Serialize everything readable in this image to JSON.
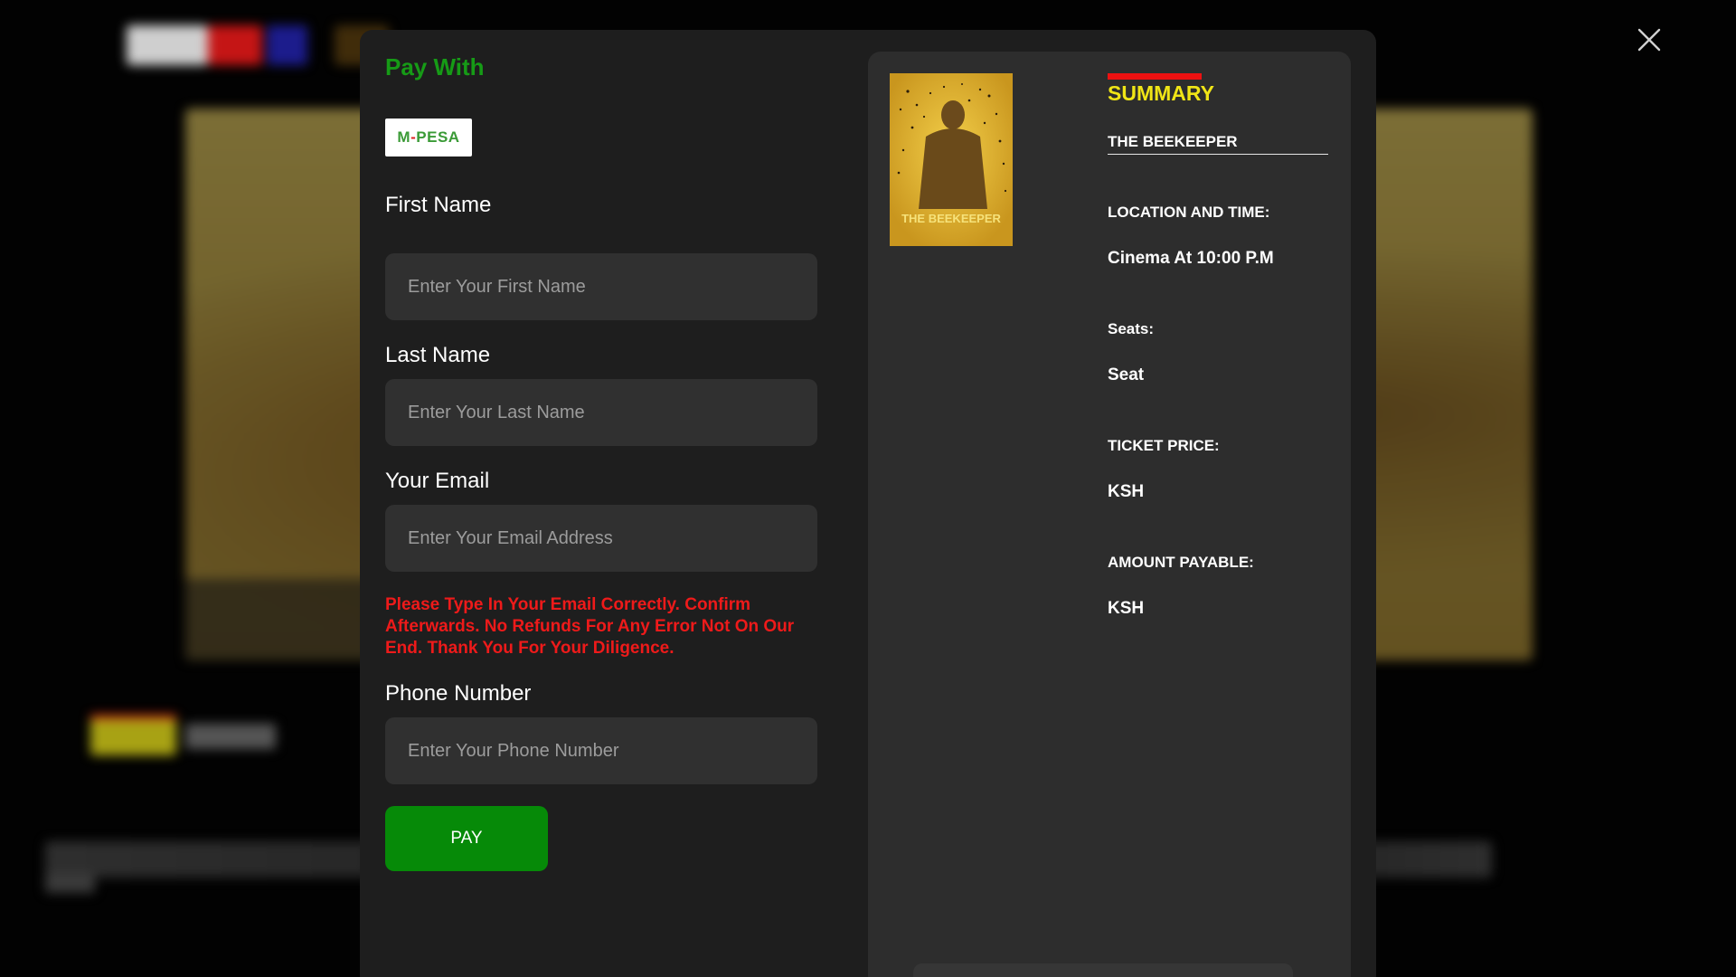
{
  "colors": {
    "accent_green": "#169b16",
    "pay_button": "#068a08",
    "warning_red": "#ee1a1a",
    "summary_yellow": "#f0e516",
    "summary_bar_red": "#ee1111",
    "modal_bg": "#1e1e1e",
    "panel_bg": "#2d2d2d",
    "input_bg": "#303030"
  },
  "modal": {
    "close_icon": "close-icon",
    "pay_with_heading": "Pay With",
    "payment_method": {
      "logo_text_1": "M",
      "logo_dash": "-",
      "logo_text_2": "PESA"
    },
    "form": {
      "first_name": {
        "label": "First Name",
        "placeholder": "Enter Your First Name",
        "value": ""
      },
      "last_name": {
        "label": "Last Name",
        "placeholder": "Enter Your Last Name",
        "value": ""
      },
      "email": {
        "label": "Your Email",
        "placeholder": "Enter Your Email Address",
        "value": ""
      },
      "email_warning": "Please Type In Your Email Correctly. Confirm Afterwards. No Refunds For Any Error Not On Our End. Thank You For Your Diligence.",
      "phone": {
        "label": "Phone Number",
        "placeholder": "Enter Your Phone Number",
        "value": ""
      },
      "pay_button": "PAY"
    },
    "summary": {
      "heading": "SUMMARY",
      "poster_title": "THE BEEKEEPER",
      "movie_title": "THE BEEKEEPER",
      "location_label": "LOCATION AND TIME:",
      "location_value": "Cinema At 10:00 P.M",
      "seats_label": "Seats:",
      "seats_value": "Seat",
      "ticket_price_label": "TICKET PRICE:",
      "ticket_price_value": "KSH",
      "amount_label": "AMOUNT PAYABLE:",
      "amount_value": "KSH"
    }
  }
}
